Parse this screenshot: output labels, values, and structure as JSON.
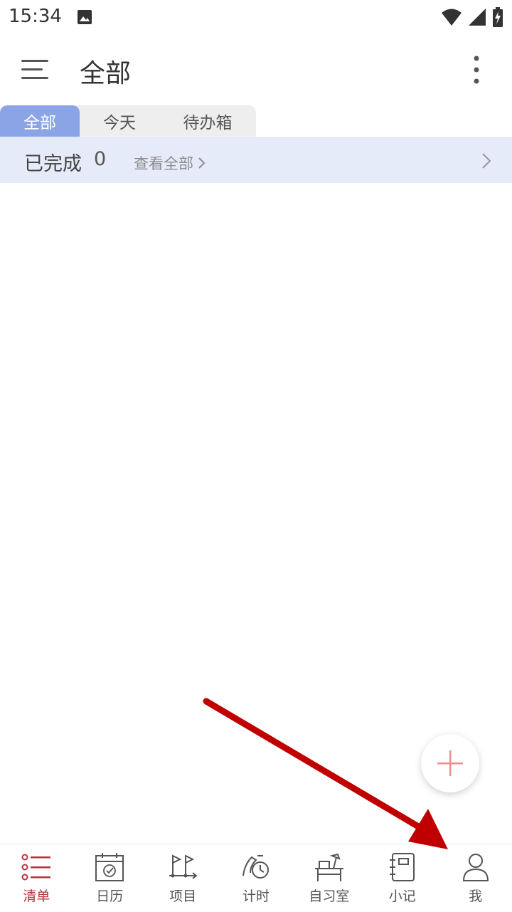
{
  "status_bar": {
    "time": "15:34"
  },
  "app_bar": {
    "title": "全部"
  },
  "tabs": [
    {
      "label": "全部",
      "active": true
    },
    {
      "label": "今天",
      "active": false
    },
    {
      "label": "待办箱",
      "active": false
    }
  ],
  "completed": {
    "label": "已完成",
    "count": "0",
    "view_all": "查看全部"
  },
  "bottom_nav": [
    {
      "label": "清单",
      "icon": "list-icon",
      "active": true
    },
    {
      "label": "日历",
      "icon": "calendar-icon",
      "active": false
    },
    {
      "label": "项目",
      "icon": "project-icon",
      "active": false
    },
    {
      "label": "计时",
      "icon": "timer-icon",
      "active": false
    },
    {
      "label": "自习室",
      "icon": "study-room-icon",
      "active": false
    },
    {
      "label": "小记",
      "icon": "notebook-icon",
      "active": false
    },
    {
      "label": "我",
      "icon": "profile-icon",
      "active": false
    }
  ],
  "colors": {
    "accent": "#b8323a",
    "tab_active": "#8aa4e6",
    "row_bg": "#e6ebfa",
    "fab_plus": "#f08c8c",
    "annotation": "#c00000"
  }
}
